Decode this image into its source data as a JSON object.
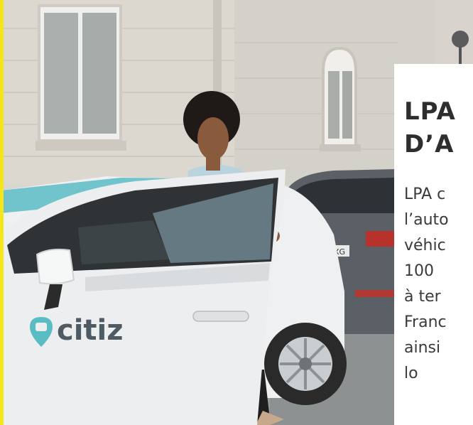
{
  "photo": {
    "brand_name": "citiz",
    "plate_text": "XG"
  },
  "card": {
    "title_lines": [
      "LPA",
      "D’A"
    ],
    "body_lines": [
      "LPA c",
      "l’auto",
      "véhic",
      "100",
      "à ter",
      "Franc",
      "ainsi",
      "lo"
    ]
  },
  "colors": {
    "accent_yellow": "#f5e61b",
    "brand_teal": "#5bbcc4",
    "car_white": "#eef0f1",
    "title_color": "#2e2e2e"
  }
}
